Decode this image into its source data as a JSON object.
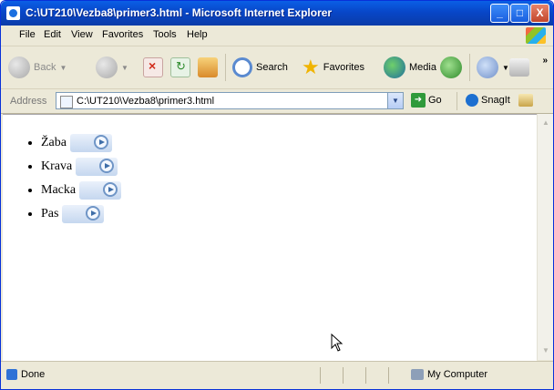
{
  "window": {
    "title": "C:\\UT210\\Vezba8\\primer3.html - Microsoft Internet Explorer",
    "min_glyph": "_",
    "max_glyph": "□",
    "close_glyph": "X"
  },
  "menu": [
    "File",
    "Edit",
    "View",
    "Favorites",
    "Tools",
    "Help"
  ],
  "toolbar": {
    "back_label": "Back",
    "search_label": "Search",
    "favorites_label": "Favorites",
    "media_label": "Media"
  },
  "address": {
    "label": "Address",
    "url": "C:\\UT210\\Vezba8\\primer3.html",
    "go_label": "Go",
    "snagit_label": "SnagIt"
  },
  "list": {
    "items": [
      {
        "label": "Žaba"
      },
      {
        "label": "Krava"
      },
      {
        "label": "Macka"
      },
      {
        "label": "Pas"
      }
    ]
  },
  "status": {
    "text": "Done",
    "zone": "My Computer"
  },
  "colors": {
    "titlebar": "#0846c8",
    "chrome": "#ece9d8",
    "close": "#c2462b"
  }
}
